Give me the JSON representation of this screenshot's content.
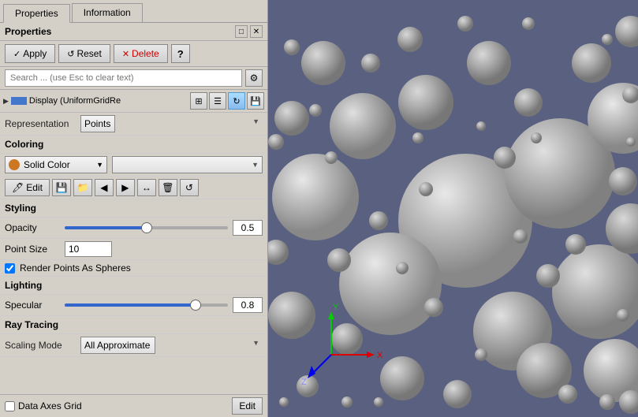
{
  "tabs": {
    "properties_label": "Properties",
    "information_label": "Information",
    "active": "properties"
  },
  "props_header": {
    "title": "Properties",
    "icon1": "□",
    "icon2": "✕"
  },
  "toolbar": {
    "apply_label": "Apply",
    "reset_label": "Reset",
    "delete_label": "Delete",
    "help_label": "?"
  },
  "search": {
    "placeholder": "Search ... (use Esc to clear text)"
  },
  "display_section": {
    "label": "Display (UniformGridRe",
    "icons": [
      "grid",
      "list",
      "refresh",
      "save"
    ]
  },
  "representation": {
    "label": "Representation",
    "value": "Points"
  },
  "coloring": {
    "section_label": "Coloring",
    "color_mode": "Solid Color",
    "color_mode2": "",
    "edit_label": "Edit"
  },
  "styling": {
    "section_label": "Styling",
    "opacity_label": "Opacity",
    "opacity_value": "0.5",
    "opacity_pct": 50,
    "point_size_label": "Point Size",
    "point_size_value": "10",
    "render_label": "Render Points As Spheres",
    "render_checked": true
  },
  "lighting": {
    "section_label": "Lighting",
    "specular_label": "Specular",
    "specular_value": "0.8",
    "specular_pct": 80
  },
  "ray_tracing": {
    "section_label": "Ray Tracing",
    "scaling_mode_label": "Scaling Mode",
    "scaling_mode_value": "All Approximate"
  },
  "bottom_bar": {
    "checkbox_label": "Data Axes Grid",
    "edit_label": "Edit"
  }
}
